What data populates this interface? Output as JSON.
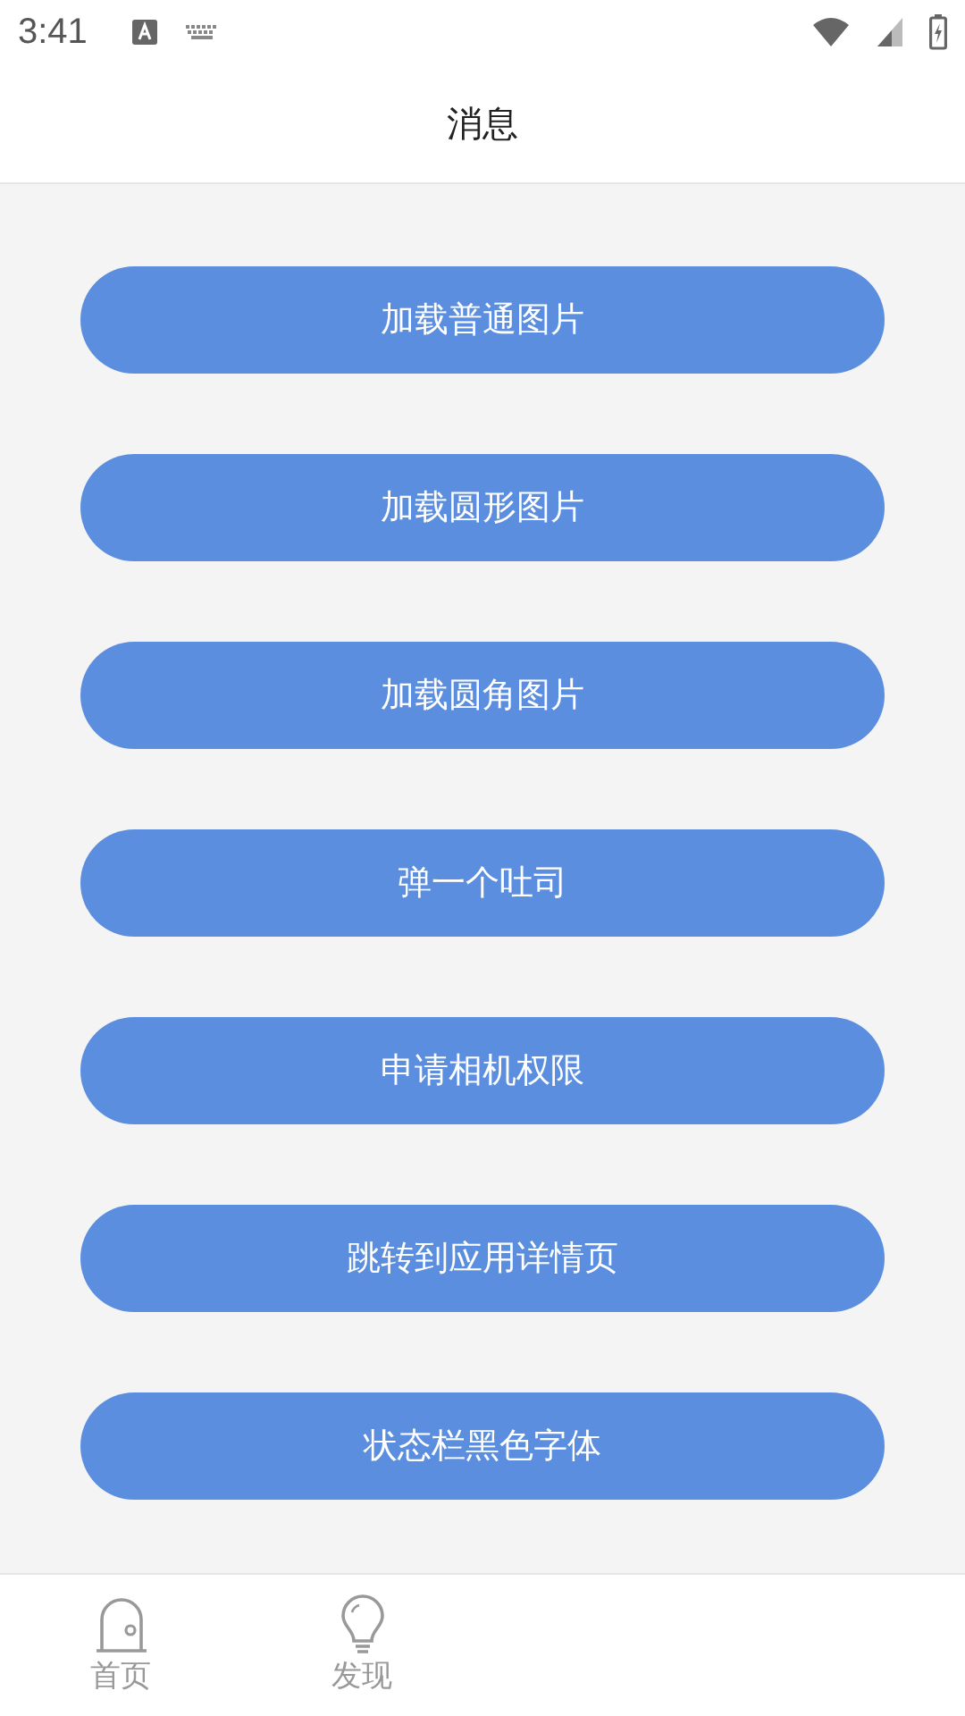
{
  "status_bar": {
    "time": "3:41"
  },
  "header": {
    "title": "消息"
  },
  "buttons": [
    "加载普通图片",
    "加载圆形图片",
    "加载圆角图片",
    "弹一个吐司",
    "申请相机权限",
    "跳转到应用详情页",
    "状态栏黑色字体"
  ],
  "tab_bar": {
    "items": [
      {
        "label": "首页",
        "kind": "home",
        "selected": false
      },
      {
        "label": "发现",
        "kind": "discover",
        "selected": false
      }
    ]
  }
}
